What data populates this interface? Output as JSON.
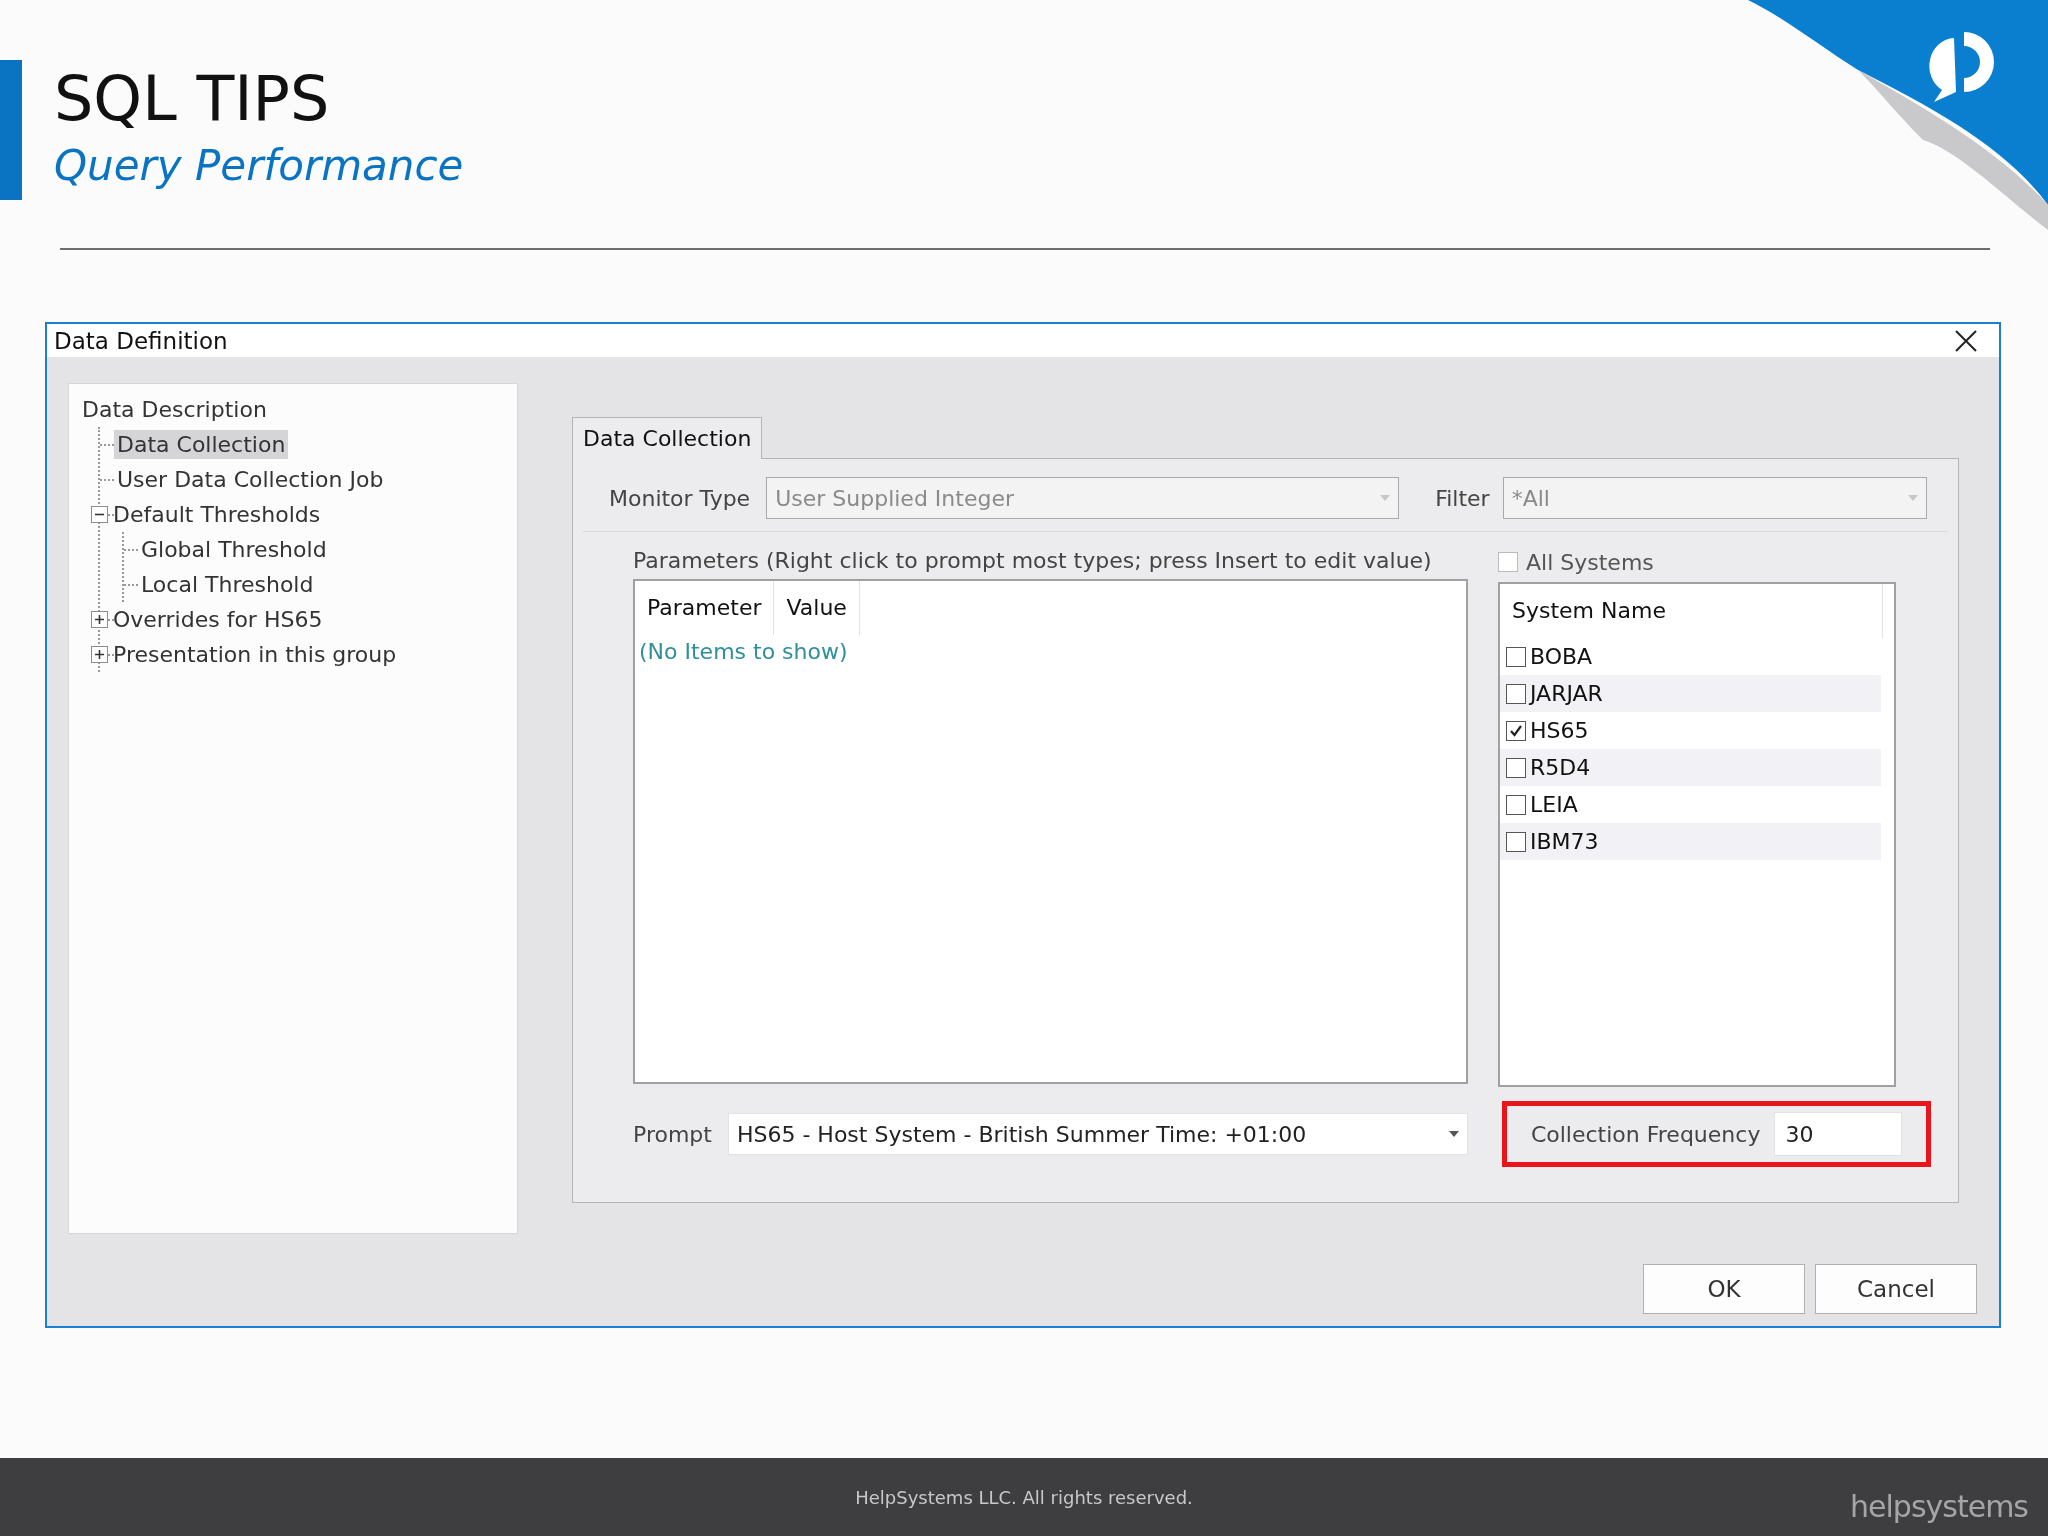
{
  "slide": {
    "title": "SQL TIPS",
    "subtitle": "Query Performance",
    "footer": "HelpSystems LLC. All rights reserved.",
    "logo": "helpsystems"
  },
  "dialog": {
    "title": "Data Definition",
    "tree": [
      {
        "label": "Data Description",
        "selected": false,
        "children": [
          {
            "label": "Data Collection",
            "selected": true
          },
          {
            "label": "User Data Collection Job",
            "selected": false
          },
          {
            "label": "Default Thresholds",
            "selected": false,
            "expanded": true,
            "children": [
              {
                "label": "Global Threshold",
                "selected": false
              },
              {
                "label": "Local Threshold",
                "selected": false
              }
            ]
          },
          {
            "label": "Overrides for HS65",
            "selected": false,
            "expanded": false
          },
          {
            "label": "Presentation in this group",
            "selected": false,
            "expanded": false
          }
        ]
      }
    ],
    "tabs": [
      {
        "label": "Data Collection",
        "selected": true
      }
    ],
    "monitor_type": {
      "label": "Monitor Type",
      "value": "User Supplied Integer"
    },
    "filter": {
      "label": "Filter",
      "value": "*All"
    },
    "parameters": {
      "caption": "Parameters (Right click to prompt most types; press Insert to edit value)",
      "columns": [
        "Parameter",
        "Value"
      ],
      "empty_text": "(No Items to show)"
    },
    "all_systems": {
      "label": "All Systems",
      "checked": false
    },
    "systems": {
      "column": "System Name",
      "rows": [
        {
          "name": "BOBA",
          "checked": false
        },
        {
          "name": "JARJAR",
          "checked": false
        },
        {
          "name": "HS65",
          "checked": true
        },
        {
          "name": "R5D4",
          "checked": false
        },
        {
          "name": "LEIA",
          "checked": false
        },
        {
          "name": "IBM73",
          "checked": false
        }
      ]
    },
    "prompt": {
      "label": "Prompt",
      "value": "HS65 - Host System - British Summer Time: +01:00"
    },
    "collection_frequency": {
      "label": "Collection Frequency",
      "value": "30",
      "highlighted": true
    },
    "buttons": [
      "OK",
      "Cancel"
    ]
  }
}
